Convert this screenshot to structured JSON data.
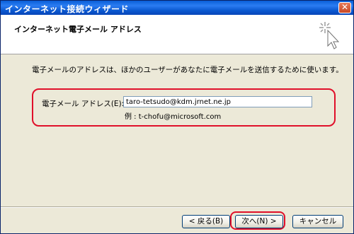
{
  "window": {
    "title": "インターネット接続ウィザード",
    "close_symbol": "✕"
  },
  "header": {
    "title": "インターネット電子メール アドレス"
  },
  "body": {
    "description": "電子メールのアドレスは、ほかのユーザーがあなたに電子メールを送信するために使います。",
    "email_label": "電子メール アドレス(E):",
    "email_value": "taro-tetsudo@kdm.jrnet.ne.jp",
    "example": "例 : t-chofu@microsoft.com"
  },
  "buttons": {
    "back": "< 戻る(B)",
    "next": "次へ(N) >",
    "cancel": "キャンセル"
  },
  "colors": {
    "titlebar": "#0a58d0",
    "highlight": "#e0102a",
    "dialog_bg": "#ece9d8"
  }
}
